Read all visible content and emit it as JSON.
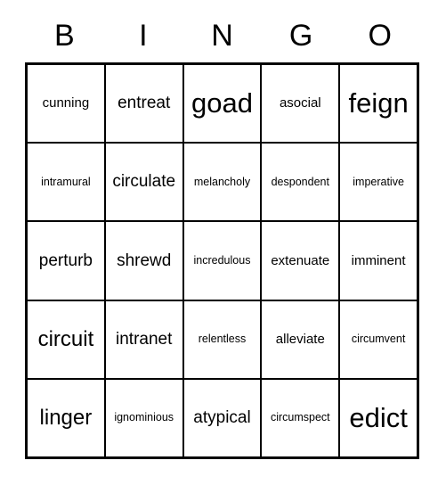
{
  "card": {
    "title": "BINGO",
    "header_letters": [
      "B",
      "I",
      "N",
      "G",
      "O"
    ],
    "rows": [
      [
        {
          "word": "cunning",
          "size": "sm"
        },
        {
          "word": "entreat",
          "size": "md"
        },
        {
          "word": "goad",
          "size": "xl"
        },
        {
          "word": "asocial",
          "size": "sm"
        },
        {
          "word": "feign",
          "size": "xl"
        }
      ],
      [
        {
          "word": "intramural",
          "size": "xs"
        },
        {
          "word": "circulate",
          "size": "md"
        },
        {
          "word": "melancholy",
          "size": "xs"
        },
        {
          "word": "despondent",
          "size": "xs"
        },
        {
          "word": "imperative",
          "size": "xs"
        }
      ],
      [
        {
          "word": "perturb",
          "size": "md"
        },
        {
          "word": "shrewd",
          "size": "md"
        },
        {
          "word": "incredulous",
          "size": "xs"
        },
        {
          "word": "extenuate",
          "size": "sm"
        },
        {
          "word": "imminent",
          "size": "sm"
        }
      ],
      [
        {
          "word": "circuit",
          "size": "lg"
        },
        {
          "word": "intranet",
          "size": "md"
        },
        {
          "word": "relentless",
          "size": "xs"
        },
        {
          "word": "alleviate",
          "size": "sm"
        },
        {
          "word": "circumvent",
          "size": "xs"
        }
      ],
      [
        {
          "word": "linger",
          "size": "lg"
        },
        {
          "word": "ignominious",
          "size": "xs"
        },
        {
          "word": "atypical",
          "size": "md"
        },
        {
          "word": "circumspect",
          "size": "xs"
        },
        {
          "word": "edict",
          "size": "xl"
        }
      ]
    ],
    "colors": {
      "background": "#ffffff",
      "text": "#000000",
      "grid_line": "#000000"
    }
  }
}
